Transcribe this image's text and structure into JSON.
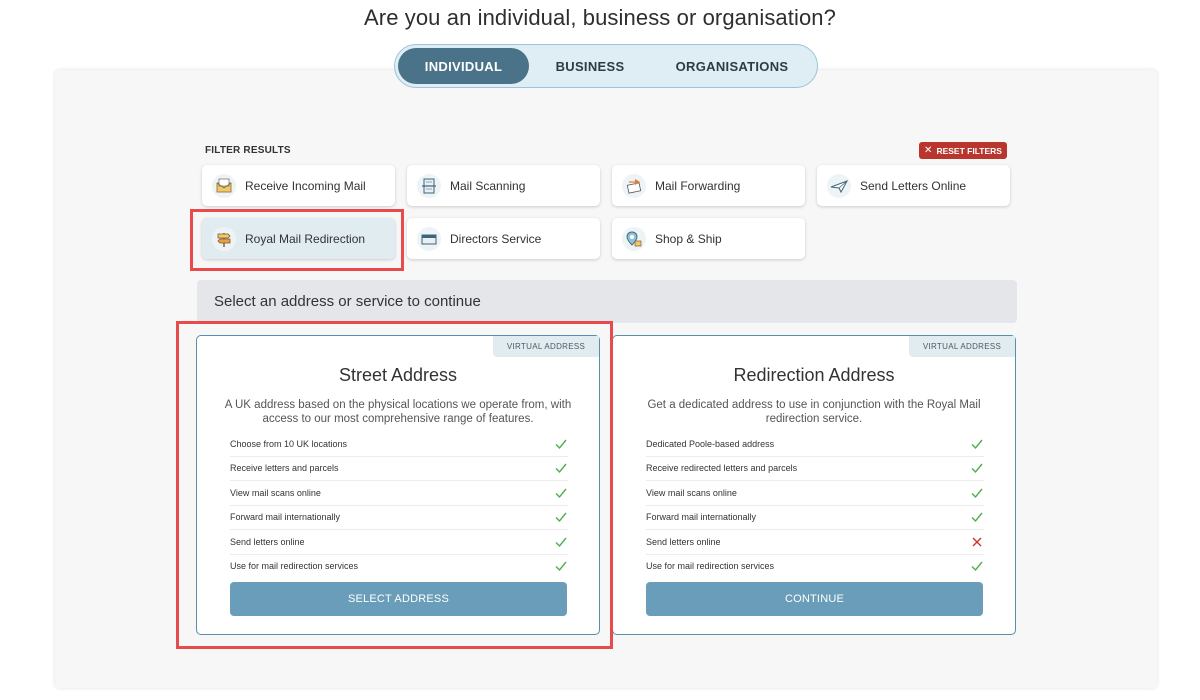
{
  "header": {
    "title": "Are you an individual, business or organisation?"
  },
  "account_types": [
    {
      "label": "INDIVIDUAL",
      "active": true
    },
    {
      "label": "BUSINESS",
      "active": false
    },
    {
      "label": "ORGANISATIONS",
      "active": false
    }
  ],
  "filters": {
    "label": "FILTER RESULTS",
    "reset_label": "RESET FILTERS",
    "items": [
      {
        "label": "Receive Incoming Mail",
        "icon": "incoming-mail-icon",
        "selected": false
      },
      {
        "label": "Mail Scanning",
        "icon": "mail-scanning-icon",
        "selected": false
      },
      {
        "label": "Mail Forwarding",
        "icon": "mail-forwarding-icon",
        "selected": false
      },
      {
        "label": "Send Letters Online",
        "icon": "paper-plane-icon",
        "selected": false
      },
      {
        "label": "Royal Mail Redirection",
        "icon": "signpost-icon",
        "selected": true
      },
      {
        "label": "Directors Service",
        "icon": "envelope-icon",
        "selected": false
      },
      {
        "label": "Shop & Ship",
        "icon": "location-pin-icon",
        "selected": false
      }
    ]
  },
  "prompt": "Select an address or service to continue",
  "cards": [
    {
      "tag": "VIRTUAL ADDRESS",
      "title": "Street Address",
      "description": "A UK address based on the physical locations we operate from, with access to our most comprehensive range of features.",
      "features": [
        {
          "label": "Choose from 10 UK locations",
          "included": true
        },
        {
          "label": "Receive letters and parcels",
          "included": true
        },
        {
          "label": "View mail scans online",
          "included": true
        },
        {
          "label": "Forward mail internationally",
          "included": true
        },
        {
          "label": "Send letters online",
          "included": true
        },
        {
          "label": "Use for mail redirection services",
          "included": true
        }
      ],
      "cta": "SELECT ADDRESS"
    },
    {
      "tag": "VIRTUAL ADDRESS",
      "title": "Redirection Address",
      "description": "Get a dedicated address to use in conjunction with the Royal Mail redirection service.",
      "features": [
        {
          "label": "Dedicated Poole-based address",
          "included": true
        },
        {
          "label": "Receive redirected letters and parcels",
          "included": true
        },
        {
          "label": "View mail scans online",
          "included": true
        },
        {
          "label": "Forward mail internationally",
          "included": true
        },
        {
          "label": "Send letters online",
          "included": false
        },
        {
          "label": "Use for mail redirection services",
          "included": true
        }
      ],
      "cta": "CONTINUE"
    }
  ],
  "colors": {
    "accent": "#4a7389",
    "button": "#6a9db9",
    "check": "#4caf50",
    "cross": "#d32f2f",
    "highlight": "#e74b4b",
    "reset": "#b9362f"
  }
}
